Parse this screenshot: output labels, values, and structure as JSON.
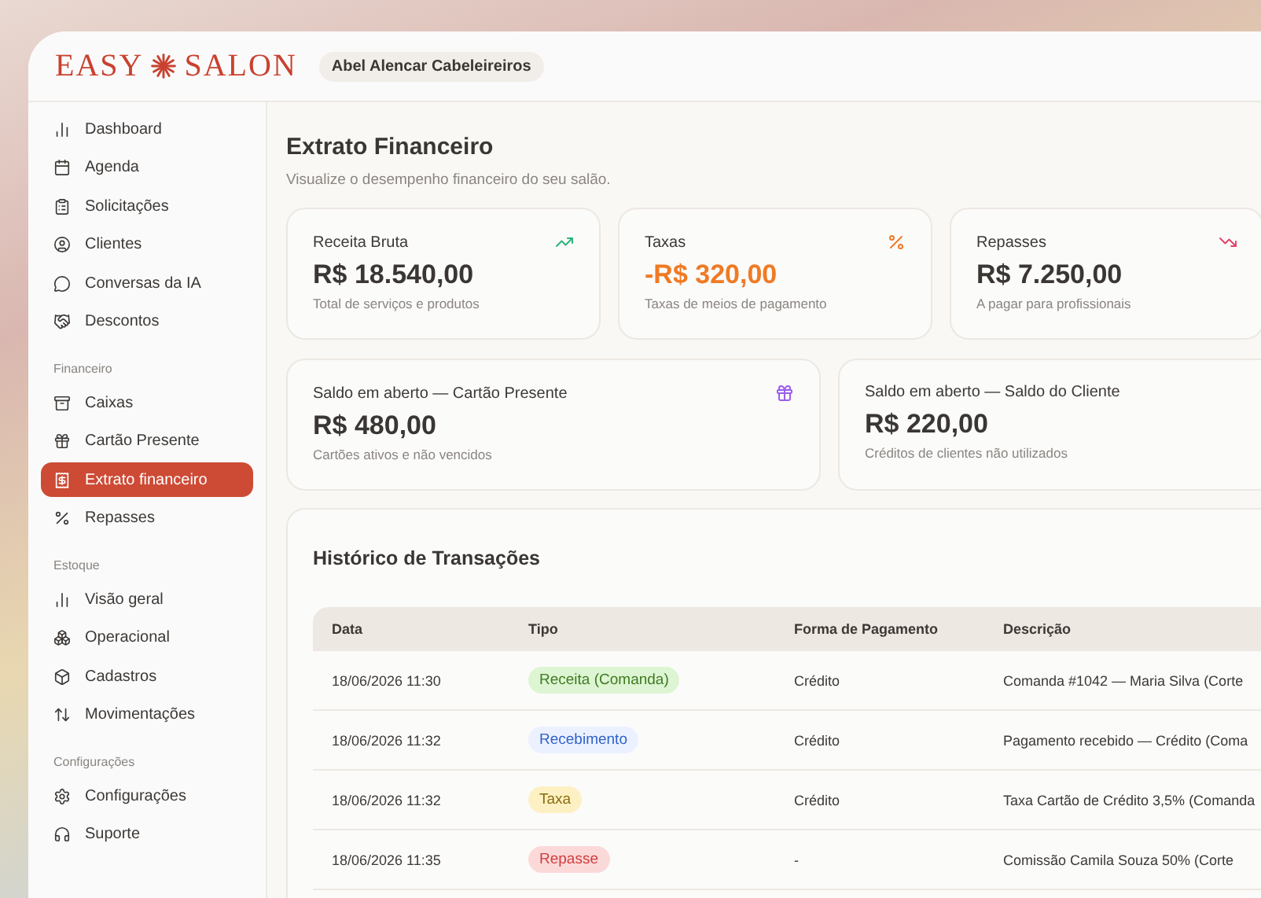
{
  "logo": {
    "left": "EASY",
    "right": "SALON"
  },
  "business": "Abel Alencar Cabeleireiros",
  "sidebar": {
    "sections": [
      {
        "items": [
          {
            "label": "Dashboard",
            "selected": false
          },
          {
            "label": "Agenda",
            "selected": false
          },
          {
            "label": "Solicitações",
            "selected": false
          },
          {
            "label": "Clientes",
            "selected": false
          },
          {
            "label": "Conversas da IA",
            "selected": false
          },
          {
            "label": "Descontos",
            "selected": false
          }
        ]
      },
      {
        "title": "Financeiro",
        "items": [
          {
            "label": "Caixas",
            "selected": false
          },
          {
            "label": "Cartão Presente",
            "selected": false
          },
          {
            "label": "Extrato financeiro",
            "selected": true
          },
          {
            "label": "Repasses",
            "selected": false
          }
        ]
      },
      {
        "title": "Estoque",
        "items": [
          {
            "label": "Visão geral",
            "selected": false
          },
          {
            "label": "Operacional",
            "selected": false
          },
          {
            "label": "Cadastros",
            "selected": false
          },
          {
            "label": "Movimentações",
            "selected": false
          }
        ]
      },
      {
        "title": "Configurações",
        "items": [
          {
            "label": "Configurações",
            "selected": false
          },
          {
            "label": "Suporte",
            "selected": false
          }
        ]
      }
    ]
  },
  "page": {
    "title": "Extrato Financeiro",
    "subtitle": "Visualize o desempenho financeiro do seu salão."
  },
  "summary_cards": [
    {
      "label": "Receita Bruta",
      "value": "R$ 18.540,00",
      "note": "Total de serviços e produtos",
      "negative": false
    },
    {
      "label": "Taxas",
      "value": "-R$ 320,00",
      "note": "Taxas de meios de pagamento",
      "negative": true
    },
    {
      "label": "Repasses",
      "value": "R$ 7.250,00",
      "note": "A pagar para profissionais",
      "negative": false
    }
  ],
  "balance_cards": [
    {
      "label": "Saldo em aberto — Cartão Presente",
      "value": "R$ 480,00",
      "note": "Cartões ativos e não vencidos",
      "negative": false
    },
    {
      "label": "Saldo em aberto — Saldo do Cliente",
      "value": "R$ 220,00",
      "note": "Créditos de clientes não utilizados",
      "negative": false
    }
  ],
  "history": {
    "title": "Histórico de Transações",
    "columns": [
      "Data",
      "Tipo",
      "Forma de Pagamento",
      "Descrição"
    ],
    "rows": [
      {
        "date": "18/06/2026 11:30",
        "type": {
          "label": "Receita (Comanda)",
          "kind": "revenue"
        },
        "payment": "Crédito",
        "description": "Comanda #1042 — Maria Silva (Corte"
      },
      {
        "date": "18/06/2026 11:32",
        "type": {
          "label": "Recebimento",
          "kind": "receipt"
        },
        "payment": "Crédito",
        "description": "Pagamento recebido — Crédito (Coma"
      },
      {
        "date": "18/06/2026 11:32",
        "type": {
          "label": "Taxa",
          "kind": "fee"
        },
        "payment": "Crédito",
        "description": "Taxa Cartão de Crédito 3,5% (Comanda"
      },
      {
        "date": "18/06/2026 11:35",
        "type": {
          "label": "Repasse",
          "kind": "payout"
        },
        "payment": "-",
        "description": "Comissão Camila Souza 50% (Corte"
      }
    ]
  }
}
